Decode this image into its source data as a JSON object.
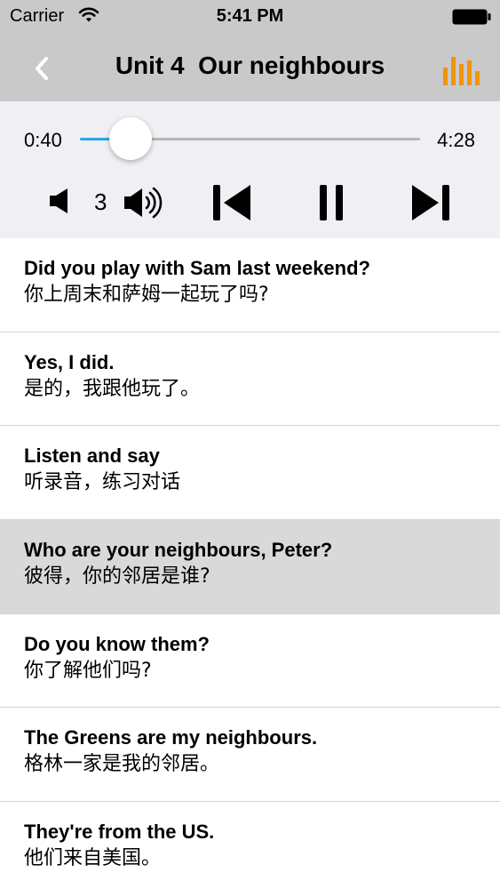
{
  "status_bar": {
    "carrier": "Carrier",
    "time": "5:41 PM",
    "icons": [
      "wifi-icon",
      "battery-icon"
    ]
  },
  "nav_bar": {
    "title": "Unit 4  Our neighbours",
    "back_icon": "chevron-left-icon",
    "right_icon": "equalizer-icon",
    "accent_color": "#f29400"
  },
  "player": {
    "current_time": "0:40",
    "total_time": "4:28",
    "progress_fraction": 0.149,
    "progress_color": "#2aa7e0",
    "volume_level": "3",
    "controls": [
      "volume-down-icon",
      "volume-up-icon",
      "skip-previous-icon",
      "pause-icon",
      "skip-next-icon"
    ]
  },
  "sentences": [
    {
      "en": "Did you play with Sam last weekend?",
      "zh": "你上周末和萨姆一起玩了吗?",
      "highlighted": false
    },
    {
      "en": "Yes, I did.",
      "zh": "是的，我跟他玩了。",
      "highlighted": false
    },
    {
      "en": "Listen and say",
      "zh": "听录音，练习对话",
      "highlighted": false
    },
    {
      "en": "Who are your neighbours, Peter?",
      "zh": "彼得，你的邻居是谁?",
      "highlighted": true
    },
    {
      "en": "Do you know them?",
      "zh": "你了解他们吗?",
      "highlighted": false
    },
    {
      "en": "The Greens are my neighbours.",
      "zh": "格林一家是我的邻居。",
      "highlighted": false
    },
    {
      "en": "They're from the US.",
      "zh": "他们来自美国。",
      "highlighted": false
    }
  ]
}
